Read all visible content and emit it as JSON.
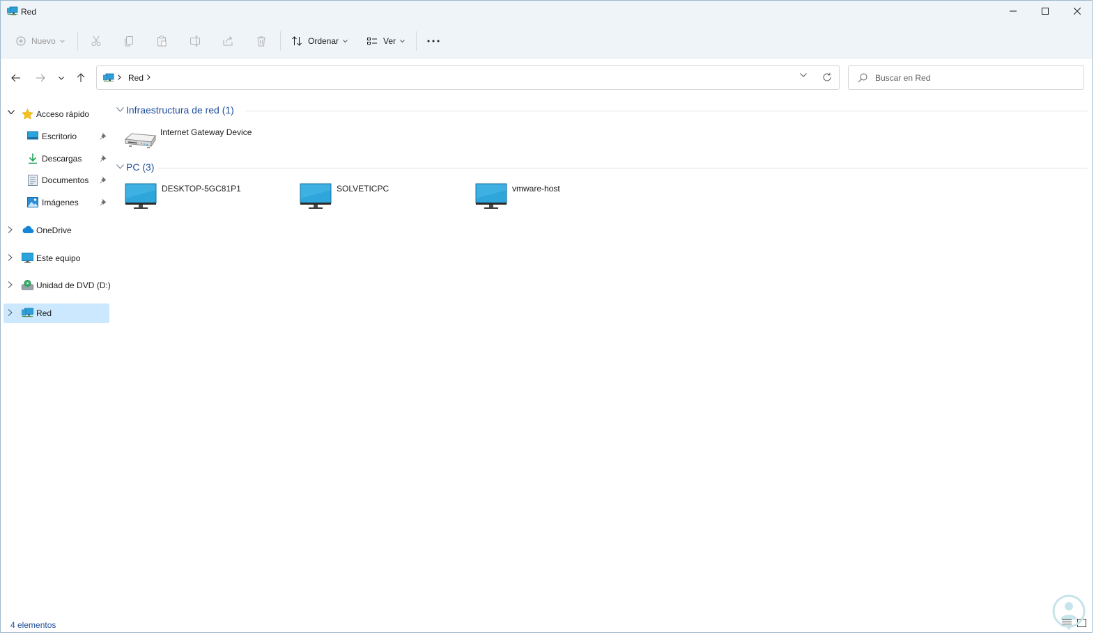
{
  "window": {
    "title": "Red",
    "controls": {
      "minimize": "minimize",
      "maximize": "maximize",
      "close": "close"
    }
  },
  "toolbar": {
    "new_label": "Nuevo",
    "sort_label": "Ordenar",
    "view_label": "Ver",
    "icons": [
      "new-icon",
      "cut-icon",
      "copy-icon",
      "paste-icon",
      "rename-icon",
      "share-icon",
      "delete-icon",
      "sort-icon",
      "view-icon",
      "more-icon"
    ]
  },
  "address": {
    "location": "Red",
    "search_placeholder": "Buscar en Red"
  },
  "sidebar": {
    "items": [
      {
        "label": "Acceso rápido",
        "icon": "star-icon"
      },
      {
        "label": "Escritorio",
        "icon": "desktop-icon",
        "pinned": true
      },
      {
        "label": "Descargas",
        "icon": "download-icon",
        "pinned": true
      },
      {
        "label": "Documentos",
        "icon": "documents-icon",
        "pinned": true
      },
      {
        "label": "Imágenes",
        "icon": "pictures-icon",
        "pinned": true
      },
      {
        "label": "OneDrive",
        "icon": "cloud-icon"
      },
      {
        "label": "Este equipo",
        "icon": "computer-icon"
      },
      {
        "label": "Unidad de DVD (D:)",
        "icon": "dvd-drive-icon"
      },
      {
        "label": "Red",
        "icon": "network-icon",
        "selected": true
      }
    ]
  },
  "content": {
    "groups": [
      {
        "title": "Infraestructura de red (1)",
        "items": [
          {
            "label": "Internet Gateway Device",
            "icon": "router-icon"
          }
        ]
      },
      {
        "title": "PC (3)",
        "items": [
          {
            "label": "DESKTOP-5GC81P1",
            "icon": "monitor-icon"
          },
          {
            "label": "SOLVETICPC",
            "icon": "monitor-icon"
          },
          {
            "label": "vmware-host",
            "icon": "monitor-icon"
          }
        ]
      }
    ]
  },
  "status": {
    "count_text": "4 elementos"
  },
  "colors": {
    "accent": "#0078d4",
    "selection": "#cce8ff",
    "chrome": "#eff4f9",
    "group_title": "#1f4e9a"
  }
}
